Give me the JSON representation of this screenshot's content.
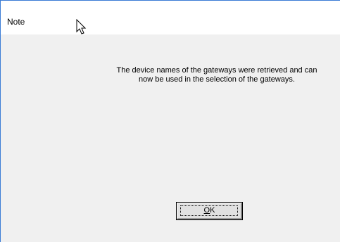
{
  "window": {
    "title": "Note"
  },
  "message": {
    "line1": "The device names of the gateways were retrieved and can",
    "line2": "now be used in the selection of the gateways."
  },
  "buttons": {
    "ok_mnemonic": "O",
    "ok_rest": "K"
  },
  "icons": {
    "cursor": "mouse-pointer-icon"
  },
  "colors": {
    "window_border": "#3a7bd5",
    "client_background": "#f0f0f0",
    "titlebar_background": "#ffffff"
  }
}
